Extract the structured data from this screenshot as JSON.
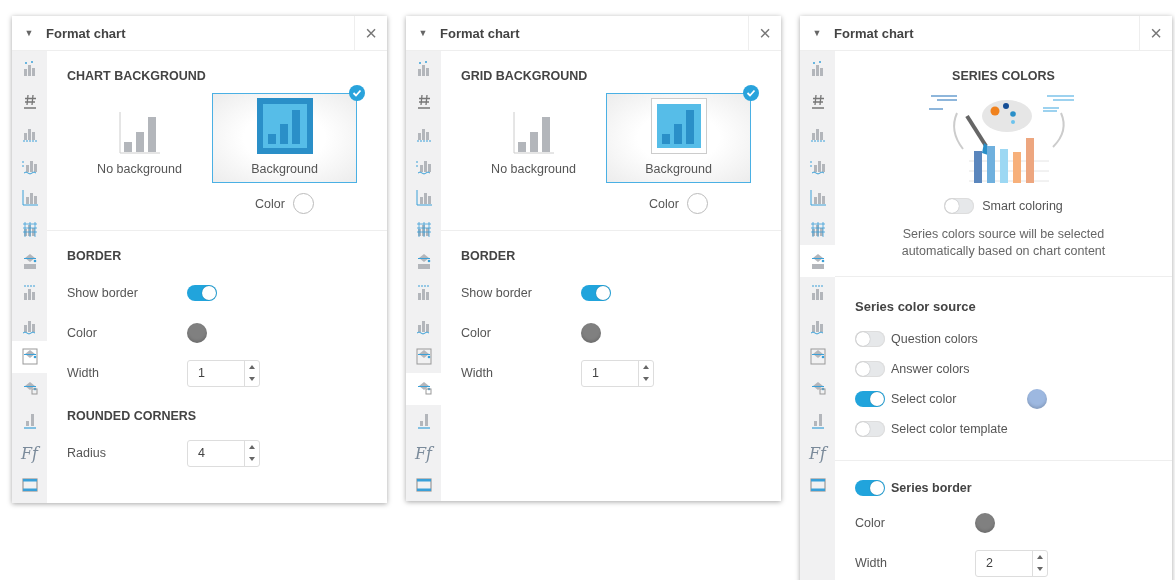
{
  "panels": [
    {
      "title": "Format chart",
      "collapse_icon": "▼",
      "close_icon": "×",
      "sidebar": [
        {
          "selected": false
        },
        {
          "selected": false
        },
        {
          "selected": false
        },
        {
          "selected": false
        },
        {
          "selected": false
        },
        {
          "selected": false
        },
        {
          "selected": false
        },
        {
          "selected": false
        },
        {
          "selected": false
        },
        {
          "selected": true
        },
        {
          "selected": false
        },
        {
          "selected": false
        },
        {
          "selected": false,
          "glyph": "Ff"
        },
        {
          "selected": false
        }
      ],
      "sections": [
        {
          "rows": [
            {
              "kind": "heading",
              "text": "CHART BACKGROUND"
            },
            {
              "kind": "cards",
              "options": [
                {
                  "label": "No background",
                  "selected": false,
                  "kind": "plain"
                },
                {
                  "label": "Background",
                  "selected": true,
                  "kind": "filled"
                }
              ]
            },
            {
              "kind": "color-pick",
              "label": "Color"
            }
          ]
        },
        {
          "rows": [
            {
              "kind": "heading",
              "text": "BORDER"
            },
            {
              "kind": "toggle",
              "label": "Show border",
              "on": true
            },
            {
              "kind": "swatch",
              "label": "Color",
              "color": "#808080"
            },
            {
              "kind": "spinner",
              "label": "Width",
              "value": "1"
            },
            {
              "kind": "heading",
              "text": "ROUNDED CORNERS"
            },
            {
              "kind": "spinner",
              "label": "Radius",
              "value": "4"
            }
          ]
        }
      ]
    },
    {
      "title": "Format chart",
      "collapse_icon": "▼",
      "close_icon": "×",
      "sidebar": [
        {
          "selected": false
        },
        {
          "selected": false
        },
        {
          "selected": false
        },
        {
          "selected": false
        },
        {
          "selected": false
        },
        {
          "selected": false
        },
        {
          "selected": false
        },
        {
          "selected": false
        },
        {
          "selected": false
        },
        {
          "selected": false
        },
        {
          "selected": true
        },
        {
          "selected": false
        },
        {
          "selected": false,
          "glyph": "Ff"
        },
        {
          "selected": false
        }
      ],
      "sections": [
        {
          "rows": [
            {
              "kind": "heading",
              "text": "GRID BACKGROUND"
            },
            {
              "kind": "cards",
              "options": [
                {
                  "label": "No background",
                  "selected": false,
                  "kind": "plain"
                },
                {
                  "label": "Background",
                  "selected": true,
                  "kind": "framed"
                }
              ]
            },
            {
              "kind": "color-pick",
              "label": "Color"
            }
          ]
        },
        {
          "rows": [
            {
              "kind": "heading",
              "text": "BORDER"
            },
            {
              "kind": "toggle",
              "label": "Show border",
              "on": true
            },
            {
              "kind": "swatch",
              "label": "Color",
              "color": "#808080"
            },
            {
              "kind": "spinner",
              "label": "Width",
              "value": "1"
            }
          ]
        }
      ]
    },
    {
      "title": "Format chart",
      "collapse_icon": "▼",
      "close_icon": "×",
      "sidebar": [
        {
          "selected": false
        },
        {
          "selected": false
        },
        {
          "selected": false
        },
        {
          "selected": false
        },
        {
          "selected": false
        },
        {
          "selected": false
        },
        {
          "selected": true
        },
        {
          "selected": false
        },
        {
          "selected": false
        },
        {
          "selected": false
        },
        {
          "selected": false
        },
        {
          "selected": false
        },
        {
          "selected": false,
          "glyph": "Ff"
        },
        {
          "selected": false
        }
      ],
      "sections": [
        {
          "rows": [
            {
              "kind": "title",
              "text": "SERIES COLORS"
            },
            {
              "kind": "illustration"
            },
            {
              "kind": "toggle-center",
              "label": "Smart coloring",
              "on": false
            },
            {
              "kind": "note",
              "text": "Series colors source will be selected automatically based on chart content"
            }
          ]
        },
        {
          "rows": [
            {
              "kind": "subheading",
              "text": "Series color source"
            },
            {
              "kind": "toggle-option",
              "label": "Question colors",
              "on": false
            },
            {
              "kind": "toggle-option",
              "label": "Answer colors",
              "on": false
            },
            {
              "kind": "toggle-option",
              "label": "Select color",
              "on": true,
              "color": "#9db8e0"
            },
            {
              "kind": "toggle-option",
              "label": "Select color template",
              "on": false
            }
          ]
        },
        {
          "rows": [
            {
              "kind": "toggle-heading",
              "label": "Series border",
              "on": true
            },
            {
              "kind": "swatch",
              "label": "Color",
              "color": "#808080"
            },
            {
              "kind": "spinner",
              "label": "Width",
              "value": "2"
            }
          ]
        }
      ]
    }
  ]
}
